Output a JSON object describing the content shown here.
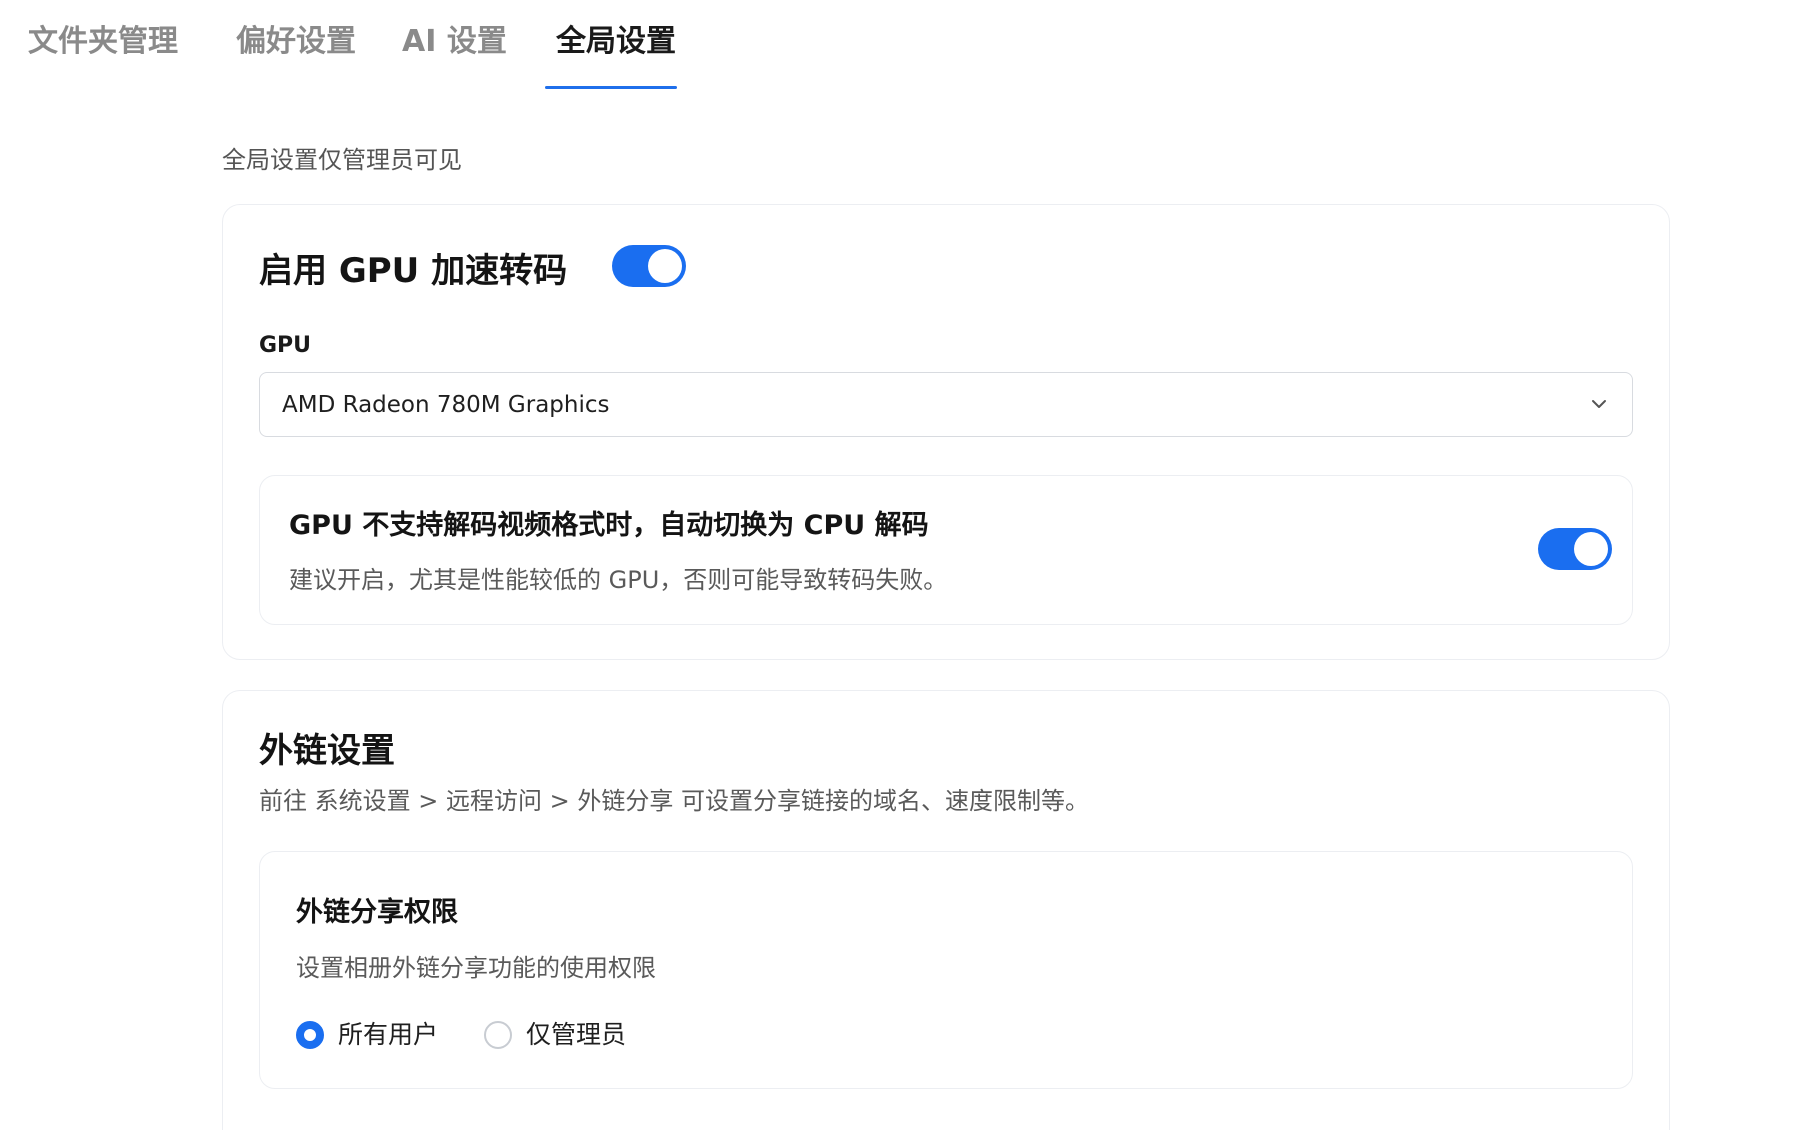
{
  "tabs": [
    {
      "label": "文件夹管理"
    },
    {
      "label": "偏好设置"
    },
    {
      "label": "AI 设置"
    },
    {
      "label": "全局设置"
    }
  ],
  "active_tab": "全局设置",
  "notice": "全局设置仅管理员可见",
  "gpu_section": {
    "title": "启用 GPU 加速转码",
    "enabled": true,
    "gpu_label": "GPU",
    "gpu_selected": "AMD Radeon 780M Graphics",
    "fallback": {
      "title": "GPU 不支持解码视频格式时，自动切换为 CPU 解码",
      "description": "建议开启，尤其是性能较低的 GPU，否则可能导致转码失败。",
      "enabled": true
    }
  },
  "link_section": {
    "title": "外链设置",
    "description": "前往 系统设置 > 远程访问 > 外链分享 可设置分享链接的域名、速度限制等。",
    "permission": {
      "title": "外链分享权限",
      "description": "设置相册外链分享功能的使用权限",
      "options": [
        {
          "label": "所有用户",
          "selected": true
        },
        {
          "label": "仅管理员",
          "selected": false
        }
      ]
    }
  },
  "colors": {
    "accent": "#1a6ef0",
    "muted_tab": "#8a8a8a",
    "border": "#eceef2"
  }
}
